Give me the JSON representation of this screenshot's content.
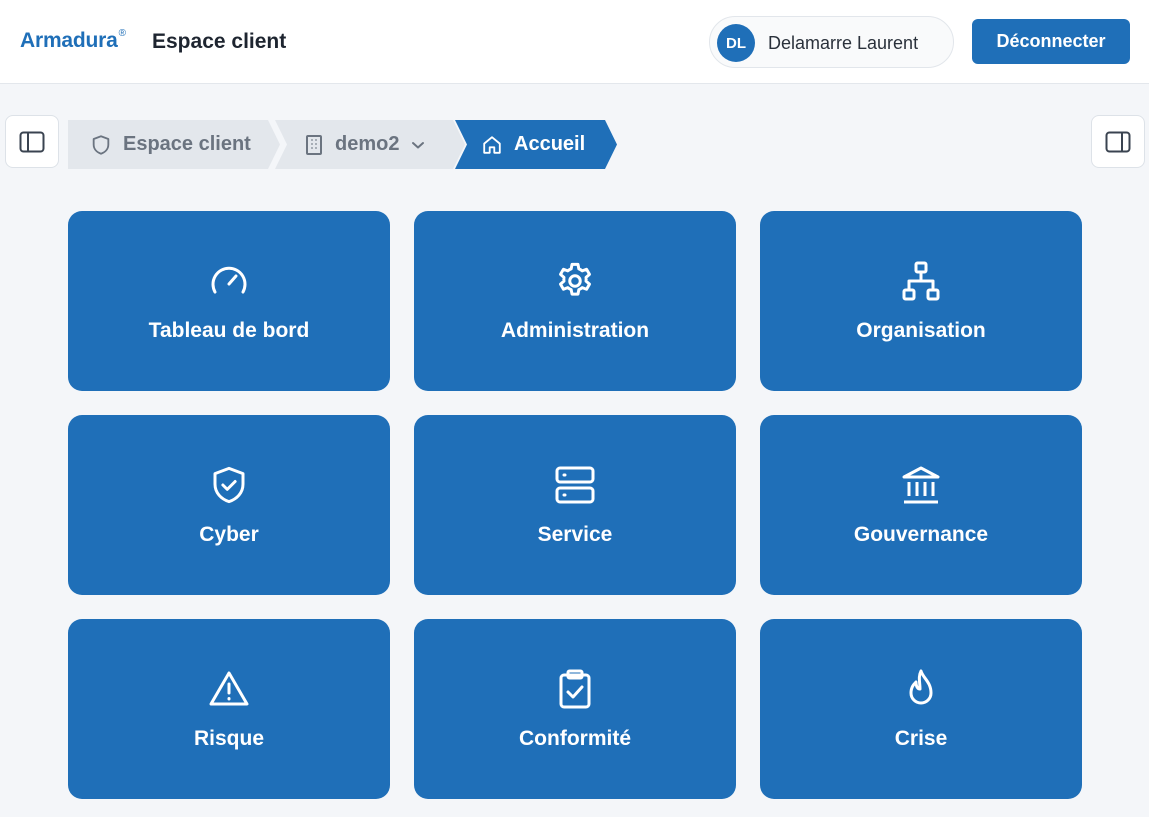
{
  "header": {
    "brand": "Armadura",
    "brand_mark": "®",
    "app_title": "Espace client",
    "user": {
      "initials": "DL",
      "name": "Delamarre Laurent"
    },
    "logout_label": "Déconnecter"
  },
  "breadcrumb": {
    "items": [
      {
        "label": "Espace client",
        "icon": "shield-icon"
      },
      {
        "label": "demo2",
        "icon": "building-icon",
        "has_dropdown": true
      },
      {
        "label": "Accueil",
        "icon": "home-icon",
        "active": true
      }
    ]
  },
  "tiles": [
    {
      "label": "Tableau de bord",
      "icon": "gauge-icon"
    },
    {
      "label": "Administration",
      "icon": "gear-icon"
    },
    {
      "label": "Organisation",
      "icon": "org-chart-icon"
    },
    {
      "label": "Cyber",
      "icon": "shield-check-icon"
    },
    {
      "label": "Service",
      "icon": "server-icon"
    },
    {
      "label": "Gouvernance",
      "icon": "landmark-icon"
    },
    {
      "label": "Risque",
      "icon": "warning-icon"
    },
    {
      "label": "Conformité",
      "icon": "clipboard-check-icon"
    },
    {
      "label": "Crise",
      "icon": "flame-icon"
    }
  ],
  "colors": {
    "primary": "#1f6fb8",
    "background": "#f4f6f9",
    "crumb_inactive": "#e3e7ec"
  }
}
